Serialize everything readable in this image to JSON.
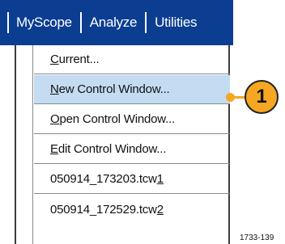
{
  "menubar": {
    "items": [
      "MyScope",
      "Analyze",
      "Utilities"
    ]
  },
  "dropdown": {
    "items": [
      {
        "prefix": "",
        "accel": "C",
        "rest": "urrent...",
        "suffix": ""
      },
      {
        "prefix": "",
        "accel": "N",
        "rest": "ew Control Window...",
        "suffix": ""
      },
      {
        "prefix": "",
        "accel": "O",
        "rest": "pen Control Window...",
        "suffix": ""
      },
      {
        "prefix": "",
        "accel": "E",
        "rest": "dit Control Window...",
        "suffix": ""
      },
      {
        "prefix": "050914_173203.tcw ",
        "accel": "1",
        "rest": "",
        "suffix": ""
      },
      {
        "prefix": "050914_172529.tcw ",
        "accel": "2",
        "rest": "",
        "suffix": ""
      }
    ],
    "highlighted_index": 1
  },
  "callout": {
    "number": "1",
    "color": "#f5a623"
  },
  "figure_id": "1733-139",
  "colors": {
    "menubar_bg": "#0b3d91",
    "highlight": "#c4dcf2"
  }
}
